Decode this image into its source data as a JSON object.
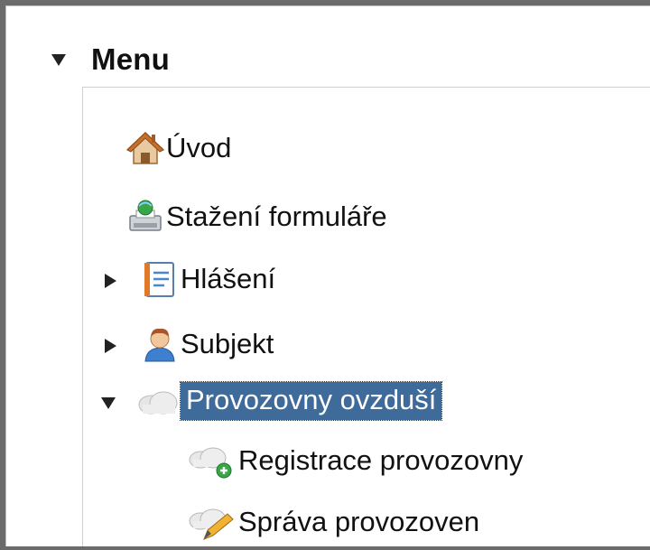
{
  "menu": {
    "title": "Menu",
    "items": [
      {
        "label": "Úvod",
        "icon": "home-icon"
      },
      {
        "label": "Stažení formuláře",
        "icon": "printer-download-icon"
      },
      {
        "label": "Hlášení",
        "icon": "notebook-icon",
        "collapsed": true
      },
      {
        "label": "Subjekt",
        "icon": "user-icon",
        "collapsed": true
      },
      {
        "label": "Provozovny ovzduší",
        "icon": "cloud-icon",
        "expanded": true,
        "selected": true,
        "children": [
          {
            "label": "Registrace provozovny",
            "icon": "cloud-add-icon"
          },
          {
            "label": "Správa provozoven",
            "icon": "cloud-edit-icon"
          }
        ]
      }
    ]
  },
  "colors": {
    "selected_background": "#3f6b9a",
    "selected_text": "#ffffff",
    "text": "#111111"
  }
}
